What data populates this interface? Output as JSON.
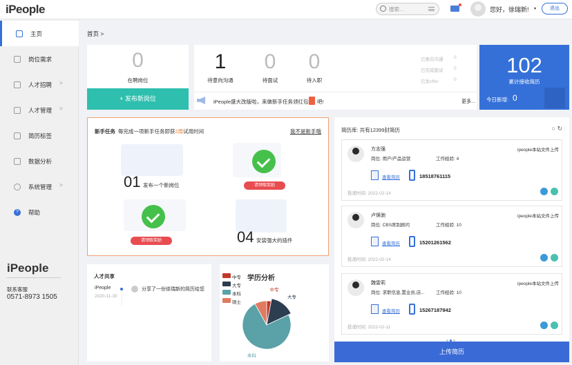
{
  "header": {
    "logo": "iPeople",
    "search_placeholder": "搜索...",
    "greeting": "您好，徐瑞新!",
    "caret": "▾",
    "logout": "退出"
  },
  "sidebar": {
    "items": [
      {
        "label": "主页",
        "icon": "home-icon",
        "active": true
      },
      {
        "label": "岗位需求",
        "icon": "briefcase-icon"
      },
      {
        "label": "人才招聘",
        "icon": "clipboard-icon",
        "arrow": ">"
      },
      {
        "label": "人才管理",
        "icon": "person-icon",
        "arrow": ">"
      },
      {
        "label": "简历标签",
        "icon": "tag-icon"
      },
      {
        "label": "数据分析",
        "icon": "bar-chart-icon"
      },
      {
        "label": "系统管理",
        "icon": "gear-icon",
        "arrow": ">"
      },
      {
        "label": "帮助",
        "icon": "help-icon"
      }
    ],
    "bottom_logo": "iPeople",
    "cs_label": "联系客服",
    "cs_phone": "0571-8973 1505"
  },
  "breadcrumb": "首页 >",
  "stats": {
    "recruiting": {
      "value": "0",
      "label": "在聘岗位"
    },
    "post_button": "+ 发布新岗位",
    "pending_comm": {
      "value": "1",
      "label": "待意向沟通"
    },
    "pending_interview": {
      "value": "0",
      "label": "待面试"
    },
    "pending_onboard": {
      "value": "0",
      "label": "待入职"
    },
    "side_list": [
      {
        "label": "已意向沟通",
        "value": "0"
      },
      {
        "label": "已完成面试",
        "value": "0"
      },
      {
        "label": "已发offer",
        "value": "0"
      }
    ],
    "total_resumes": {
      "value": "102",
      "label": "累计接收简历"
    },
    "today_new": {
      "label": "今日新增:",
      "value": "0"
    }
  },
  "notice": {
    "text": "iPeople盛大改版啦，来做新手任务领红包",
    "suffix": "吧!",
    "more": "更多..."
  },
  "tasks": {
    "title": "新手任务",
    "subtitle_prefix": "每完成一项新手任务即获",
    "subtitle_highlight": "2周",
    "subtitle_suffix": "试用时间",
    "skip": "我不是新手哦",
    "items": [
      {
        "num": "01",
        "label": "发布一个新岗位"
      },
      {
        "redeem": "请领取奖励"
      },
      {
        "redeem": "请领取奖励"
      },
      {
        "num": "04",
        "label": "安装强大的插件"
      }
    ]
  },
  "talent_share": {
    "title": "人才共享",
    "org": "iPeople",
    "date": "2020-11-30",
    "message": "分享了一份徐瑞新的简历给您"
  },
  "education": {
    "title": "学历分析"
  },
  "chart_data": {
    "type": "pie",
    "title": "学历分析",
    "categories": [
      "中专",
      "大专",
      "本科",
      "硕士"
    ],
    "values": [
      3,
      15,
      74,
      8
    ],
    "colors": [
      "#c0392b",
      "#2c3e50",
      "#5aa1a8",
      "#e07b5f"
    ],
    "slice_labels": [
      "中专",
      "大专",
      "本科"
    ]
  },
  "resume_pool": {
    "title": "简历库: 共有12399封简历",
    "items": [
      {
        "name": "方志强",
        "position": "岗位: 用户/产品运营",
        "experience": "工作经验: 4",
        "source": "ipeople本站文件上传",
        "view": "查看简历",
        "phone": "18518761115",
        "date": "投递时间: 2022-02-14"
      },
      {
        "name": "卢焕驰",
        "position": "岗位: CBS席别顾问",
        "experience": "工作经验: 10",
        "source": "ipeople本站文件上传",
        "view": "查看简历",
        "phone": "15201261562",
        "date": "投递时间: 2022-02-14"
      },
      {
        "name": "魏雷莉",
        "position": "岗位: 求职信息,置业员,店...",
        "experience": "工作经验: 10",
        "source": "ipeople本站文件上传",
        "view": "查看简历",
        "phone": "15267187942",
        "date": "投递时间: 2022-02-11"
      }
    ],
    "upload": "上传简历"
  }
}
